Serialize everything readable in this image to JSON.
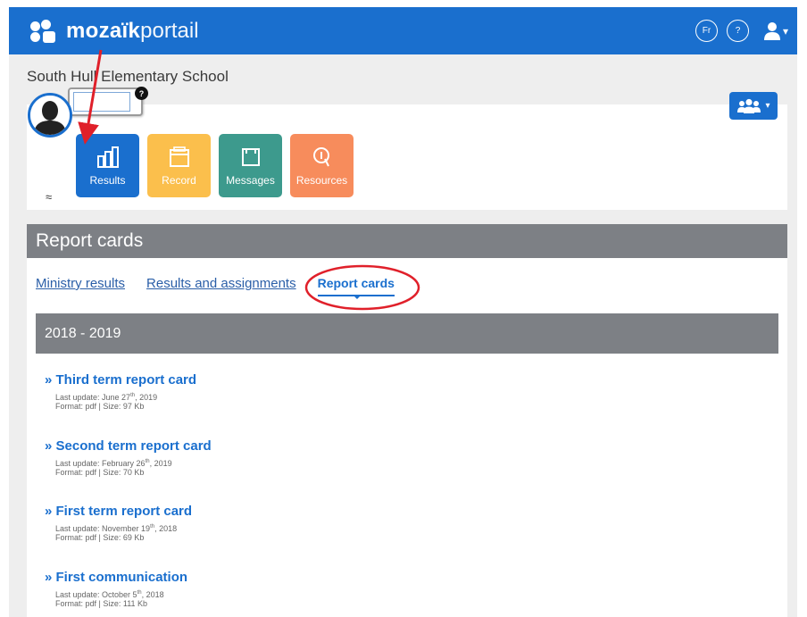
{
  "header": {
    "logo_bold": "mozaïk",
    "logo_light": "portail",
    "lang_label": "Fr",
    "help_label": "?",
    "user_caret": "▾"
  },
  "school_name": "South Hull Elementary School",
  "profile": {
    "help_badge": "?"
  },
  "group_button": {
    "caret": "▾"
  },
  "tiles": [
    {
      "label": "Results",
      "color": "#1a6fce"
    },
    {
      "label": "Record",
      "color": "#fbbf4c"
    },
    {
      "label": "Messages",
      "color": "#3d9a8d"
    },
    {
      "label": "Resources",
      "color": "#f78c5c"
    }
  ],
  "collapse_glyph": "≈",
  "section_title": "Report cards",
  "tabs": [
    {
      "label": "Ministry results",
      "active": false
    },
    {
      "label": "Results and assignments",
      "active": false
    },
    {
      "label": "Report cards",
      "active": true
    }
  ],
  "year": "2018 - 2019",
  "reports": [
    {
      "title": "» Third term report card",
      "update_prefix": "Last update: June 27",
      "update_sup": "th",
      "update_suffix": ", 2019",
      "format": "Format: pdf | Size: 97 Kb"
    },
    {
      "title": "» Second term report card",
      "update_prefix": "Last update: February 26",
      "update_sup": "th",
      "update_suffix": ", 2019",
      "format": "Format: pdf | Size: 70 Kb"
    },
    {
      "title": "» First term report card",
      "update_prefix": "Last update: November 19",
      "update_sup": "th",
      "update_suffix": ", 2018",
      "format": "Format: pdf | Size: 69 Kb"
    },
    {
      "title": "» First communication",
      "update_prefix": "Last update: October 5",
      "update_sup": "th",
      "update_suffix": ", 2018",
      "format": "Format: pdf | Size: 111 Kb"
    }
  ],
  "colors": {
    "brand_blue": "#1a6fce",
    "header_grey": "#7d8085",
    "annotation_red": "#e0202a"
  }
}
